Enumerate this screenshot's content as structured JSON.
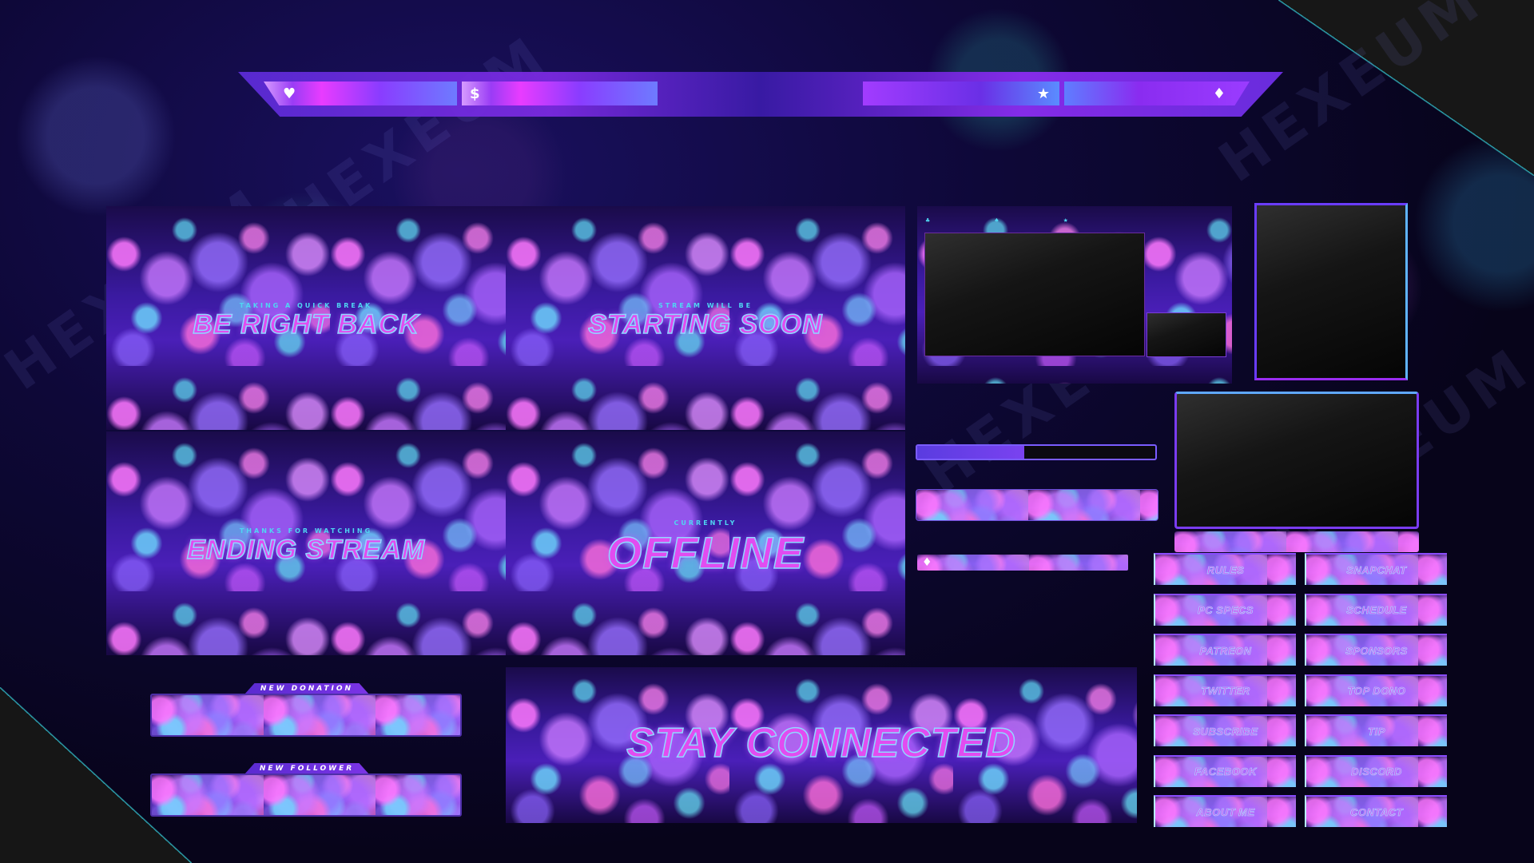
{
  "watermark_text": "HEXEUM",
  "top_bar": {
    "segments": [
      {
        "icon": "heart-icon",
        "glyph": "♥"
      },
      {
        "icon": "dollar-icon",
        "glyph": "$"
      },
      {
        "icon": "star-icon",
        "glyph": "★"
      },
      {
        "icon": "diamond-icon",
        "glyph": "♦"
      }
    ]
  },
  "scenes": {
    "brb": {
      "subtitle": "TAKING A QUICK BREAK",
      "title": "BE RIGHT BACK"
    },
    "starting": {
      "subtitle": "STREAM WILL BE",
      "title": "STARTING SOON"
    },
    "ending": {
      "subtitle": "THANKS FOR WATCHING",
      "title": "ENDING STREAM"
    },
    "offline": {
      "subtitle": "CURRENTLY",
      "title": "OFFLINE"
    },
    "stay": {
      "title": "STAY CONNECTED"
    }
  },
  "alerts": {
    "donation": "NEW DONATION",
    "follower": "NEW FOLLOWER"
  },
  "goal_bar": {
    "progress": 0.45
  },
  "ticker": {
    "icon": "diamond-icon",
    "glyph": "♦"
  },
  "mini_icons": [
    {
      "name": "group-icon",
      "glyph": "♣"
    },
    {
      "name": "chat-icon",
      "glyph": "♠"
    },
    {
      "name": "star-icon",
      "glyph": "★"
    }
  ],
  "info_panels": [
    [
      "RULES",
      "SNAPCHAT"
    ],
    [
      "PC SPECS",
      "SCHEDULE"
    ],
    [
      "PATREON",
      "SPONSORS"
    ],
    [
      "TWITTER",
      "TOP DONO"
    ],
    [
      "SUBSCRIBE",
      "TIP"
    ],
    [
      "FACEBOOK",
      "DISCORD"
    ],
    [
      "ABOUT ME",
      "CONTACT"
    ]
  ],
  "colors": {
    "accent_pink": "#e14cf0",
    "accent_cyan": "#4fd6f2",
    "accent_purple": "#7a2ae0"
  }
}
